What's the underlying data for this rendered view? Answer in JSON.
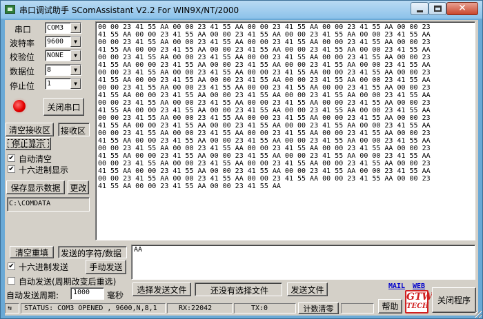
{
  "window": {
    "title": "串口调试助手 SComAssistant V2.2 For WIN9X/NT/2000",
    "min_glyph": "",
    "max_glyph": "",
    "close_glyph": "✕"
  },
  "settings": {
    "port_label": "串口",
    "port_value": "COM3",
    "baud_label": "波特率",
    "baud_value": "9600",
    "parity_label": "校验位",
    "parity_value": "NONE",
    "databits_label": "数据位",
    "databits_value": "8",
    "stopbits_label": "停止位",
    "stopbits_value": "1",
    "dropdown_glyph": "▼",
    "led_color": "#e00000",
    "close_port_label": "关闭串口"
  },
  "receive": {
    "clear_label": "清空接收区",
    "area_label": "接收区",
    "stop_display_label": "停止显示",
    "auto_clear_label": "自动清空",
    "auto_clear_checked": "✔",
    "hex_display_label": "十六进制显示",
    "hex_display_checked": "✔",
    "save_label": "保存显示数据",
    "change_label": "更改",
    "path_value": "C:\\COMDATA",
    "data_lines": [
      "00 00 23 41 55 AA 00 00 23 41 55 AA 00 00 23 41 55 AA 00 00 23 41 55 AA 00 00 23",
      "41 55 AA 00 00 23 41 55 AA 00 00 23 41 55 AA 00 00 23 41 55 AA 00 00 23 41 55 AA",
      "00 00 23 41 55 AA 00 00 23 41 55 AA 00 00 23 41 55 AA 00 00 23 41 55 AA 00 00 23",
      "41 55 AA 00 00 23 41 55 AA 00 00 23 41 55 AA 00 00 23 41 55 AA 00 00 23 41 55 AA",
      "00 00 23 41 55 AA 00 00 23 41 55 AA 00 00 23 41 55 AA 00 00 23 41 55 AA 00 00 23",
      "41 55 AA 00 00 23 41 55 AA 00 00 23 41 55 AA 00 00 23 41 55 AA 00 00 23 41 55 AA",
      "00 00 23 41 55 AA 00 00 23 41 55 AA 00 00 23 41 55 AA 00 00 23 41 55 AA 00 00 23",
      "41 55 AA 00 00 23 41 55 AA 00 00 23 41 55 AA 00 00 23 41 55 AA 00 00 23 41 55 AA",
      "00 00 23 41 55 AA 00 00 23 41 55 AA 00 00 23 41 55 AA 00 00 23 41 55 AA 00 00 23",
      "41 55 AA 00 00 23 41 55 AA 00 00 23 41 55 AA 00 00 23 41 55 AA 00 00 23 41 55 AA",
      "00 00 23 41 55 AA 00 00 23 41 55 AA 00 00 23 41 55 AA 00 00 23 41 55 AA 00 00 23",
      "41 55 AA 00 00 23 41 55 AA 00 00 23 41 55 AA 00 00 23 41 55 AA 00 00 23 41 55 AA",
      "00 00 23 41 55 AA 00 00 23 41 55 AA 00 00 23 41 55 AA 00 00 23 41 55 AA 00 00 23",
      "41 55 AA 00 00 23 41 55 AA 00 00 23 41 55 AA 00 00 23 41 55 AA 00 00 23 41 55 AA",
      "00 00 23 41 55 AA 00 00 23 41 55 AA 00 00 23 41 55 AA 00 00 23 41 55 AA 00 00 23",
      "41 55 AA 00 00 23 41 55 AA 00 00 23 41 55 AA 00 00 23 41 55 AA 00 00 23 41 55 AA",
      "00 00 23 41 55 AA 00 00 23 41 55 AA 00 00 23 41 55 AA 00 00 23 41 55 AA 00 00 23",
      "41 55 AA 00 00 23 41 55 AA 00 00 23 41 55 AA 00 00 23 41 55 AA 00 00 23 41 55 AA",
      "00 00 23 41 55 AA 00 00 23 41 55 AA 00 00 23 41 55 AA 00 00 23 41 55 AA 00 00 23",
      "41 55 AA 00 00 23 41 55 AA 00 00 23 41 55 AA 00 00 23 41 55 AA 00 00 23 41 55 AA",
      "00 00 23 41 55 AA 00 00 23 41 55 AA 00 00 23 41 55 AA 00 00 23 41 55 AA 00 00 23",
      "41 55 AA 00 00 23 41 55 AA 00 00 23 41 55 AA"
    ]
  },
  "send": {
    "clear_label": "清空重填",
    "area_label": "发送的字符/数据",
    "content": "AA",
    "hex_send_label": "十六进制发送",
    "hex_send_checked": "✔",
    "manual_send_label": "手动发送",
    "auto_send_label": "自动发送(周期改变后重选)",
    "auto_send_checked": "",
    "period_label": "自动发送周期:",
    "period_value": "1000",
    "period_unit": "毫秒",
    "choose_file_label": "选择发送文件",
    "file_status": "还没有选择文件",
    "send_file_label": "发送文件",
    "mail_link": "MAIL",
    "web_link": "WEB",
    "help_label": "帮助",
    "logo_line1": "GTW",
    "logo_line2": "TECH",
    "close_app_label": "关闭程序"
  },
  "status": {
    "icon_glyph": "⇆",
    "status_text": "STATUS: COM3 OPENED , 9600,N,8,1",
    "rx_text": "RX:22042",
    "tx_text": "TX:0",
    "count_clear_label": "计数清零"
  }
}
